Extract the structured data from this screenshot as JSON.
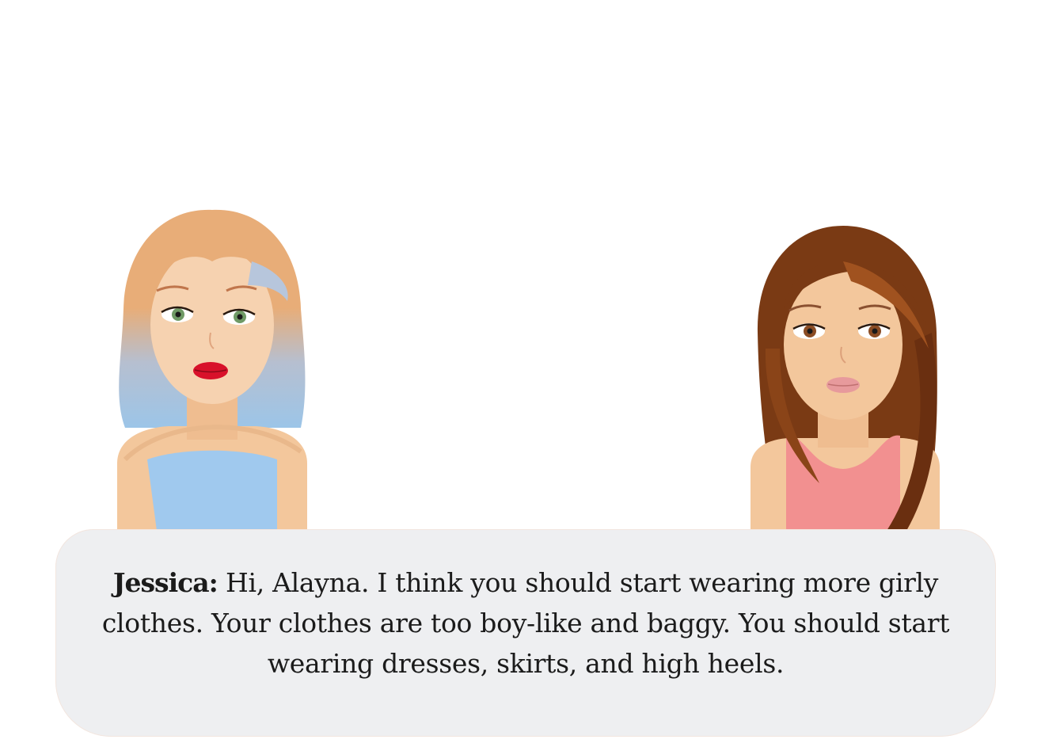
{
  "dialogue": {
    "speaker": "Jessica:",
    "text": "Hi, Alayna. I think you should start wearing more girly clothes. Your clothes are too boy-like and baggy. You should start wearing dresses, skirts, and high heels."
  },
  "colors": {
    "background": "#ffffff",
    "dialogue_box": "#eeeff1",
    "jessica_hair": "#e8ad78",
    "jessica_hair_tips": "#9cc5e8",
    "jessica_top": "#a0c9ee",
    "jessica_lips": "#d8112a",
    "alayna_hair": "#7a3a14",
    "alayna_top": "#f29090",
    "skin": "#f3c79c"
  }
}
